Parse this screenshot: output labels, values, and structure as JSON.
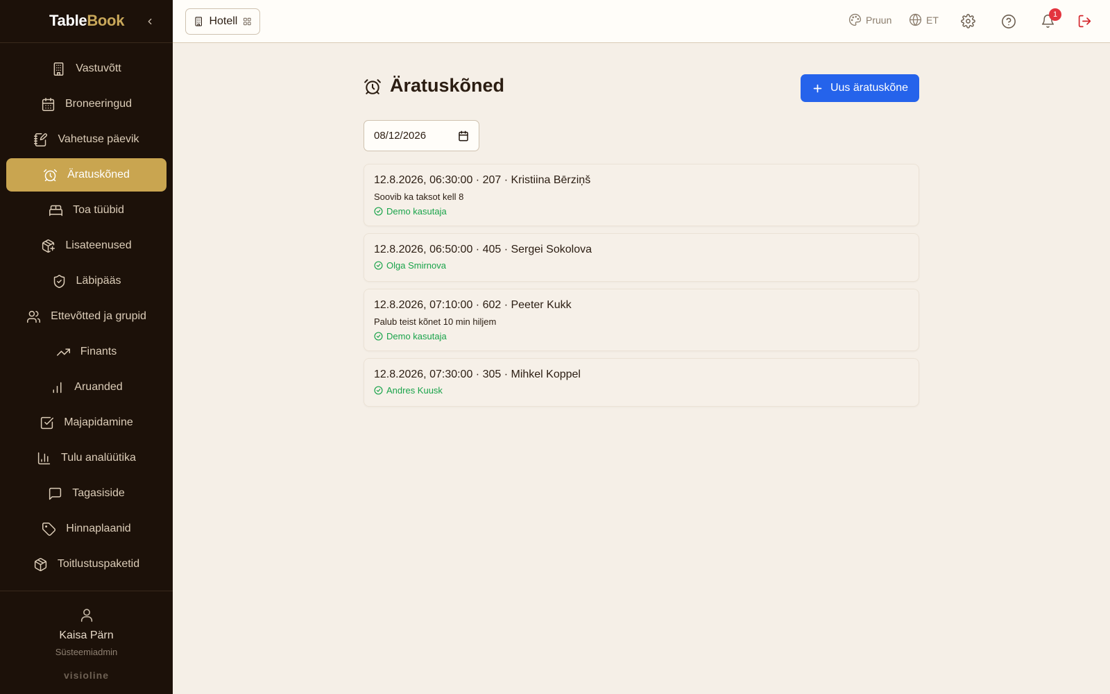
{
  "app": {
    "logo_part1": "Table",
    "logo_part2": "Book"
  },
  "sidebar": {
    "items": [
      {
        "label": "Vastuvõtt",
        "icon": "building-icon"
      },
      {
        "label": "Broneeringud",
        "icon": "calendar-icon"
      },
      {
        "label": "Vahetuse päevik",
        "icon": "notebook-pen-icon"
      },
      {
        "label": "Äratuskõned",
        "icon": "alarm-clock-icon",
        "active": true
      },
      {
        "label": "Toa tüübid",
        "icon": "bed-icon"
      },
      {
        "label": "Lisateenused",
        "icon": "package-plus-icon"
      },
      {
        "label": "Läbipääs",
        "icon": "shield-check-icon"
      },
      {
        "label": "Ettevõtted ja grupid",
        "icon": "users-icon"
      },
      {
        "label": "Finants",
        "icon": "trending-up-icon"
      },
      {
        "label": "Aruanded",
        "icon": "bar-chart-icon"
      },
      {
        "label": "Majapidamine",
        "icon": "check-square-icon"
      },
      {
        "label": "Tulu analüütika",
        "icon": "chart-column-icon"
      },
      {
        "label": "Tagasiside",
        "icon": "message-square-icon"
      },
      {
        "label": "Hinnaplaanid",
        "icon": "tag-icon"
      },
      {
        "label": "Toitlustuspaketid",
        "icon": "package-icon"
      }
    ],
    "user": {
      "name": "Kaisa Pärn",
      "role": "Süsteemiadmin"
    },
    "brand": "visioline"
  },
  "topbar": {
    "hotel_label": "Hotell",
    "theme_label": "Pruun",
    "language_label": "ET",
    "notifications_count": "1"
  },
  "main": {
    "title": "Äratuskõned",
    "add_button_label": "Uus äratuskõne",
    "date_value": "08/12/2026",
    "calls": [
      {
        "title": "12.8.2026, 06:30:00 · 207 · Kristiina Bērziņš",
        "note": "Soovib ka taksot kell 8",
        "by": "Demo kasutaja"
      },
      {
        "title": "12.8.2026, 06:50:00 · 405 · Sergei Sokolova",
        "note": "",
        "by": "Olga Smirnova"
      },
      {
        "title": "12.8.2026, 07:10:00 · 602 · Peeter Kukk",
        "note": "Palub teist kõnet 10 min hiljem",
        "by": "Demo kasutaja"
      },
      {
        "title": "12.8.2026, 07:30:00 · 305 · Mihkel Koppel",
        "note": "",
        "by": "Andres Kuusk"
      }
    ]
  },
  "colors": {
    "sidebar_bg": "#1c1109",
    "active_item": "#c9a550",
    "primary": "#2563eb",
    "success": "#19a34a",
    "badge": "#e3343e",
    "logout": "#d4262c"
  }
}
